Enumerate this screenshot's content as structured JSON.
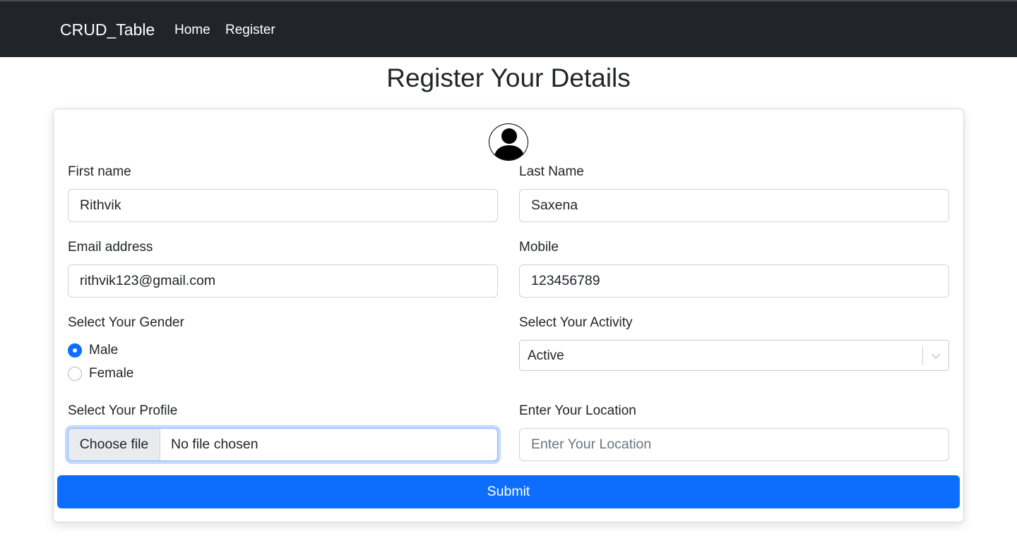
{
  "navbar": {
    "brand": "CRUD_Table",
    "links": [
      "Home",
      "Register"
    ]
  },
  "page": {
    "title": "Register Your Details"
  },
  "form": {
    "avatar_icon": "user-avatar-icon",
    "first_name": {
      "label": "First name",
      "value": "Rithvik"
    },
    "last_name": {
      "label": "Last Name",
      "value": "Saxena"
    },
    "email": {
      "label": "Email address",
      "value": "rithvik123@gmail.com"
    },
    "mobile": {
      "label": "Mobile",
      "value": "123456789"
    },
    "gender": {
      "label": "Select Your Gender",
      "options": [
        "Male",
        "Female"
      ],
      "selected": "Male"
    },
    "activity": {
      "label": "Select Your Activity",
      "value": "Active",
      "icon": "chevron-down-icon"
    },
    "profile": {
      "label": "Select Your Profile",
      "button_label": "Choose file",
      "status": "No file chosen"
    },
    "location": {
      "label": "Enter Your Location",
      "placeholder": "Enter Your Location",
      "value": ""
    },
    "submit_label": "Submit"
  },
  "colors": {
    "navbar_bg": "#212529",
    "primary": "#0d6efd",
    "text": "#212529",
    "border": "#ced4da"
  }
}
